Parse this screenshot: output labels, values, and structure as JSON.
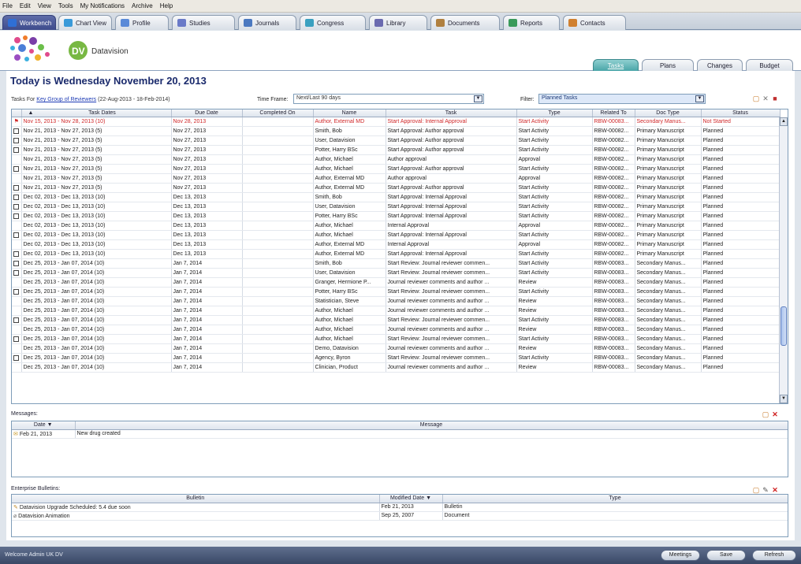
{
  "menu": [
    "File",
    "Edit",
    "View",
    "Tools",
    "My Notifications",
    "Archive",
    "Help"
  ],
  "top_tabs": [
    {
      "label": "Workbench",
      "icon": "home-icon",
      "active": true
    },
    {
      "label": "Chart View",
      "icon": "chart-view-icon"
    },
    {
      "label": "Profile",
      "icon": "profile-icon"
    },
    {
      "label": "Studies",
      "icon": "studies-icon"
    },
    {
      "label": "Journals",
      "icon": "journals-icon"
    },
    {
      "label": "Congress",
      "icon": "congress-icon"
    },
    {
      "label": "Library",
      "icon": "library-icon"
    },
    {
      "label": "Documents",
      "icon": "documents-icon"
    },
    {
      "label": "Reports",
      "icon": "reports-icon"
    },
    {
      "label": "Contacts",
      "icon": "contacts-icon"
    }
  ],
  "brand": "Datavision",
  "sub_tabs": [
    {
      "label": "Tasks",
      "active": true
    },
    {
      "label": "Plans"
    },
    {
      "label": "Changes"
    },
    {
      "label": "Budget"
    }
  ],
  "today": "Today is Wednesday November 20, 2013",
  "tasks_for": {
    "prefix": "Tasks For",
    "group": "Key Group of Reviewers",
    "range": "(22-Aug-2013 - 18-Feb-2014)"
  },
  "timeframe": {
    "label": "Time Frame:",
    "value": "Next/Last 90 days"
  },
  "filter": {
    "label": "Filter:",
    "value": "Planned Tasks"
  },
  "task_columns": [
    "Task Dates",
    "Due Date",
    "Completed On",
    "Name",
    "Task",
    "Type",
    "Related To",
    "Doc Type",
    "Status"
  ],
  "tasks": [
    {
      "cb": "flag",
      "dates": "Nov 15, 2013 - Nov 28, 2013 (10)",
      "due": "Nov 28, 2013",
      "done": "",
      "name": "Author, External MD",
      "task": "Start Approval: Internal Approval",
      "type": "Start Activity",
      "rel": "RBW-00083...",
      "doc": "Secondary Manus...",
      "status": "Not Started",
      "red": true
    },
    {
      "cb": "box",
      "dates": "Nov 21, 2013 - Nov 27, 2013 (5)",
      "due": "Nov 27, 2013",
      "done": "",
      "name": "Smith, Bob",
      "task": "Start Approval: Author approval",
      "type": "Start Activity",
      "rel": "RBW-00082...",
      "doc": "Primary Manuscript",
      "status": "Planned"
    },
    {
      "cb": "box",
      "dates": "Nov 21, 2013 - Nov 27, 2013 (5)",
      "due": "Nov 27, 2013",
      "done": "",
      "name": "User, Datavision",
      "task": "Start Approval: Author approval",
      "type": "Start Activity",
      "rel": "RBW-00082...",
      "doc": "Primary Manuscript",
      "status": "Planned"
    },
    {
      "cb": "box",
      "dates": "Nov 21, 2013 - Nov 27, 2013 (5)",
      "due": "Nov 27, 2013",
      "done": "",
      "name": "Potter, Harry BSc",
      "task": "Start Approval: Author approval",
      "type": "Start Activity",
      "rel": "RBW-00082...",
      "doc": "Primary Manuscript",
      "status": "Planned"
    },
    {
      "cb": "",
      "dates": "Nov 21, 2013 - Nov 27, 2013 (5)",
      "due": "Nov 27, 2013",
      "done": "",
      "name": "Author, Michael",
      "task": "Author approval",
      "type": "Approval",
      "rel": "RBW-00082...",
      "doc": "Primary Manuscript",
      "status": "Planned"
    },
    {
      "cb": "box",
      "dates": "Nov 21, 2013 - Nov 27, 2013 (5)",
      "due": "Nov 27, 2013",
      "done": "",
      "name": "Author, Michael",
      "task": "Start Approval: Author approval",
      "type": "Start Activity",
      "rel": "RBW-00082...",
      "doc": "Primary Manuscript",
      "status": "Planned"
    },
    {
      "cb": "",
      "dates": "Nov 21, 2013 - Nov 27, 2013 (5)",
      "due": "Nov 27, 2013",
      "done": "",
      "name": "Author, External MD",
      "task": "Author approval",
      "type": "Approval",
      "rel": "RBW-00082...",
      "doc": "Primary Manuscript",
      "status": "Planned"
    },
    {
      "cb": "box",
      "dates": "Nov 21, 2013 - Nov 27, 2013 (5)",
      "due": "Nov 27, 2013",
      "done": "",
      "name": "Author, External MD",
      "task": "Start Approval: Author approval",
      "type": "Start Activity",
      "rel": "RBW-00082...",
      "doc": "Primary Manuscript",
      "status": "Planned"
    },
    {
      "cb": "box",
      "dates": "Dec 02, 2013 - Dec 13, 2013 (10)",
      "due": "Dec 13, 2013",
      "done": "",
      "name": "Smith, Bob",
      "task": "Start Approval: Internal Approval",
      "type": "Start Activity",
      "rel": "RBW-00082...",
      "doc": "Primary Manuscript",
      "status": "Planned"
    },
    {
      "cb": "box",
      "dates": "Dec 02, 2013 - Dec 13, 2013 (10)",
      "due": "Dec 13, 2013",
      "done": "",
      "name": "User, Datavision",
      "task": "Start Approval: Internal Approval",
      "type": "Start Activity",
      "rel": "RBW-00082...",
      "doc": "Primary Manuscript",
      "status": "Planned"
    },
    {
      "cb": "box",
      "dates": "Dec 02, 2013 - Dec 13, 2013 (10)",
      "due": "Dec 13, 2013",
      "done": "",
      "name": "Potter, Harry BSc",
      "task": "Start Approval: Internal Approval",
      "type": "Start Activity",
      "rel": "RBW-00082...",
      "doc": "Primary Manuscript",
      "status": "Planned"
    },
    {
      "cb": "",
      "dates": "Dec 02, 2013 - Dec 13, 2013 (10)",
      "due": "Dec 13, 2013",
      "done": "",
      "name": "Author, Michael",
      "task": "Internal Approval",
      "type": "Approval",
      "rel": "RBW-00082...",
      "doc": "Primary Manuscript",
      "status": "Planned"
    },
    {
      "cb": "box",
      "dates": "Dec 02, 2013 - Dec 13, 2013 (10)",
      "due": "Dec 13, 2013",
      "done": "",
      "name": "Author, Michael",
      "task": "Start Approval: Internal Approval",
      "type": "Start Activity",
      "rel": "RBW-00082...",
      "doc": "Primary Manuscript",
      "status": "Planned"
    },
    {
      "cb": "",
      "dates": "Dec 02, 2013 - Dec 13, 2013 (10)",
      "due": "Dec 13, 2013",
      "done": "",
      "name": "Author, External MD",
      "task": "Internal Approval",
      "type": "Approval",
      "rel": "RBW-00082...",
      "doc": "Primary Manuscript",
      "status": "Planned"
    },
    {
      "cb": "box",
      "dates": "Dec 02, 2013 - Dec 13, 2013 (10)",
      "due": "Dec 13, 2013",
      "done": "",
      "name": "Author, External MD",
      "task": "Start Approval: Internal Approval",
      "type": "Start Activity",
      "rel": "RBW-00082...",
      "doc": "Primary Manuscript",
      "status": "Planned"
    },
    {
      "cb": "box",
      "dates": "Dec 25, 2013 - Jan 07, 2014 (10)",
      "due": "Jan 7, 2014",
      "done": "",
      "name": "Smith, Bob",
      "task": "Start Review: Journal reviewer commen...",
      "type": "Start Activity",
      "rel": "RBW-00083...",
      "doc": "Secondary Manus...",
      "status": "Planned"
    },
    {
      "cb": "box",
      "dates": "Dec 25, 2013 - Jan 07, 2014 (10)",
      "due": "Jan 7, 2014",
      "done": "",
      "name": "User, Datavision",
      "task": "Start Review: Journal reviewer commen...",
      "type": "Start Activity",
      "rel": "RBW-00083...",
      "doc": "Secondary Manus...",
      "status": "Planned"
    },
    {
      "cb": "",
      "dates": "Dec 25, 2013 - Jan 07, 2014 (10)",
      "due": "Jan 7, 2014",
      "done": "",
      "name": "Granger, Hermione P...",
      "task": "Journal reviewer comments and author ...",
      "type": "Review",
      "rel": "RBW-00083...",
      "doc": "Secondary Manus...",
      "status": "Planned"
    },
    {
      "cb": "box",
      "dates": "Dec 25, 2013 - Jan 07, 2014 (10)",
      "due": "Jan 7, 2014",
      "done": "",
      "name": "Potter, Harry BSc",
      "task": "Start Review: Journal reviewer commen...",
      "type": "Start Activity",
      "rel": "RBW-00083...",
      "doc": "Secondary Manus...",
      "status": "Planned"
    },
    {
      "cb": "",
      "dates": "Dec 25, 2013 - Jan 07, 2014 (10)",
      "due": "Jan 7, 2014",
      "done": "",
      "name": "Statistician, Steve",
      "task": "Journal reviewer comments and author ...",
      "type": "Review",
      "rel": "RBW-00083...",
      "doc": "Secondary Manus...",
      "status": "Planned"
    },
    {
      "cb": "",
      "dates": "Dec 25, 2013 - Jan 07, 2014 (10)",
      "due": "Jan 7, 2014",
      "done": "",
      "name": "Author, Michael",
      "task": "Journal reviewer comments and author ...",
      "type": "Review",
      "rel": "RBW-00083...",
      "doc": "Secondary Manus...",
      "status": "Planned"
    },
    {
      "cb": "box",
      "dates": "Dec 25, 2013 - Jan 07, 2014 (10)",
      "due": "Jan 7, 2014",
      "done": "",
      "name": "Author, Michael",
      "task": "Start Review: Journal reviewer commen...",
      "type": "Start Activity",
      "rel": "RBW-00083...",
      "doc": "Secondary Manus...",
      "status": "Planned"
    },
    {
      "cb": "",
      "dates": "Dec 25, 2013 - Jan 07, 2014 (10)",
      "due": "Jan 7, 2014",
      "done": "",
      "name": "Author, Michael",
      "task": "Journal reviewer comments and author ...",
      "type": "Review",
      "rel": "RBW-00083...",
      "doc": "Secondary Manus...",
      "status": "Planned"
    },
    {
      "cb": "box",
      "dates": "Dec 25, 2013 - Jan 07, 2014 (10)",
      "due": "Jan 7, 2014",
      "done": "",
      "name": "Author, Michael",
      "task": "Start Review: Journal reviewer commen...",
      "type": "Start Activity",
      "rel": "RBW-00083...",
      "doc": "Secondary Manus...",
      "status": "Planned"
    },
    {
      "cb": "",
      "dates": "Dec 25, 2013 - Jan 07, 2014 (10)",
      "due": "Jan 7, 2014",
      "done": "",
      "name": "Demo, Datavision",
      "task": "Journal reviewer comments and author ...",
      "type": "Review",
      "rel": "RBW-00083...",
      "doc": "Secondary Manus...",
      "status": "Planned"
    },
    {
      "cb": "box",
      "dates": "Dec 25, 2013 - Jan 07, 2014 (10)",
      "due": "Jan 7, 2014",
      "done": "",
      "name": "Agency, Byron",
      "task": "Start Review: Journal reviewer commen...",
      "type": "Start Activity",
      "rel": "RBW-00083...",
      "doc": "Secondary Manus...",
      "status": "Planned"
    },
    {
      "cb": "",
      "dates": "Dec 25, 2013 - Jan 07, 2014 (10)",
      "due": "Jan 7, 2014",
      "done": "",
      "name": "Clinician, Product",
      "task": "Journal reviewer comments and author ...",
      "type": "Review",
      "rel": "RBW-00083...",
      "doc": "Secondary Manus...",
      "status": "Planned"
    }
  ],
  "messages": {
    "title": "Messages:",
    "columns": [
      "Date",
      "Message"
    ],
    "rows": [
      {
        "date": "Feb 21, 2013",
        "message": "New drug created"
      }
    ]
  },
  "bulletins": {
    "title": "Enterprise Bulletins:",
    "columns": [
      "Bulletin",
      "Modified Date",
      "Type"
    ],
    "rows": [
      {
        "bulletin": "Datavision Upgrade Scheduled: 5.4 due soon",
        "date": "Feb 21, 2013",
        "type": "Bulletin"
      },
      {
        "bulletin": "Datavision Animation",
        "date": "Sep 25, 2007",
        "type": "Document"
      }
    ]
  },
  "status": {
    "welcome": "Welcome Admin UK DV",
    "buttons": [
      "Meetings",
      "Save",
      "Refresh"
    ]
  },
  "colors": {
    "accent": "#3e4c8c",
    "red": "#d0282a",
    "tasks_tab": "#4aa5a8"
  }
}
